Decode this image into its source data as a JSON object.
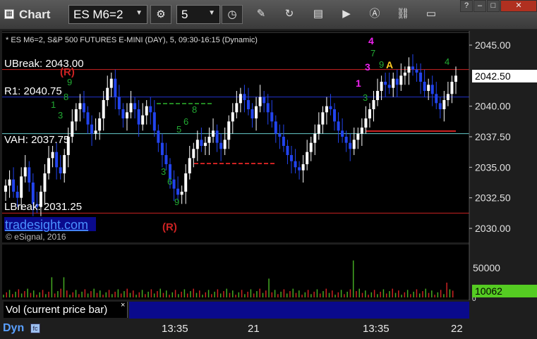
{
  "window": {
    "title": "Chart",
    "symbol": "ES M6=2",
    "interval": "5"
  },
  "chart_header": "* ES M6=2, S&P 500 FUTURES E-MINI (DAY), 5, 09:30-16:15 (Dynamic)",
  "levels": {
    "ubreak": "UBreak: 2043.00",
    "r1": "R1: 2040.75",
    "vah": "VAH: 2037.75",
    "lbreak": "LBreak: 2031.25"
  },
  "watermark": "tradesight.com",
  "copyright": "© eSignal, 2016",
  "markers": {
    "r_label": "(R)",
    "count_4": "4",
    "count_3": "3",
    "count_1": "1",
    "a_label": "A"
  },
  "price_axis": {
    "ticks": [
      "2045.00",
      "2042.50",
      "2040.00",
      "2037.50",
      "2035.00",
      "2032.50",
      "2030.00"
    ],
    "current": "2042.50",
    "current_color": "#ffffff"
  },
  "volume_axis": {
    "tick": "50000",
    "current": "10062",
    "current_color": "#55cc22",
    "zero": "0"
  },
  "vol_legend": "Vol (current price bar)",
  "vol_close": "×",
  "bottom": {
    "dyn_label": "Dyn",
    "dyn_icon": "fc",
    "time_labels": [
      "13:35",
      "21",
      "13:35",
      "22"
    ]
  },
  "colors": {
    "up_bar": "#ffffff",
    "down_bar": "#2244ee",
    "ubreak_line": "#cc2222",
    "r1_line": "#2233cc",
    "vah_line": "#66cccc",
    "lbreak_line": "#cc2222",
    "vol_up": "#44aa22",
    "vol_down": "#cc2222"
  },
  "chart_data": {
    "type": "candlestick",
    "ylim": [
      2029.0,
      2046.5
    ],
    "reference_lines": [
      {
        "name": "UBreak",
        "value": 2043.0
      },
      {
        "name": "R1",
        "value": 2040.75
      },
      {
        "name": "VAH",
        "value": 2037.75
      },
      {
        "name": "LBreak",
        "value": 2031.25
      }
    ],
    "close_series": [
      2033.5,
      2034.0,
      2033.0,
      2032.5,
      2034.25,
      2035.0,
      2033.75,
      2032.0,
      2031.75,
      2033.0,
      2034.5,
      2035.75,
      2036.25,
      2035.0,
      2034.5,
      2036.0,
      2037.5,
      2038.75,
      2039.75,
      2040.25,
      2039.5,
      2038.5,
      2037.75,
      2038.0,
      2039.0,
      2040.5,
      2041.5,
      2042.25,
      2040.75,
      2039.75,
      2039.0,
      2039.5,
      2040.25,
      2039.75,
      2038.5,
      2039.25,
      2040.0,
      2039.5,
      2038.0,
      2037.0,
      2036.0,
      2035.25,
      2034.0,
      2033.25,
      2032.75,
      2033.0,
      2034.5,
      2035.75,
      2036.5,
      2037.25,
      2036.75,
      2037.0,
      2037.5,
      2038.0,
      2037.0,
      2036.5,
      2037.25,
      2038.75,
      2039.5,
      2040.25,
      2041.0,
      2040.5,
      2039.75,
      2039.0,
      2040.0,
      2040.75,
      2040.25,
      2039.5,
      2038.75,
      2037.75,
      2037.5,
      2036.75,
      2036.0,
      2035.5,
      2035.0,
      2034.75,
      2035.25,
      2036.25,
      2037.0,
      2037.75,
      2038.5,
      2039.5,
      2040.0,
      2039.75,
      2038.75,
      2038.0,
      2037.5,
      2037.0,
      2036.5,
      2037.25,
      2037.75,
      2038.25,
      2039.0,
      2039.75,
      2040.5,
      2041.25,
      2042.0,
      2041.75,
      2041.5,
      2042.25,
      2041.75,
      2042.5,
      2042.75,
      2043.25,
      2043.0,
      2042.75,
      2042.0,
      2041.25,
      2041.75,
      2041.0,
      2040.25,
      2039.75,
      2040.5,
      2041.0,
      2042.0,
      2042.5
    ],
    "volume_max": 60000,
    "volume_current": 10062
  }
}
